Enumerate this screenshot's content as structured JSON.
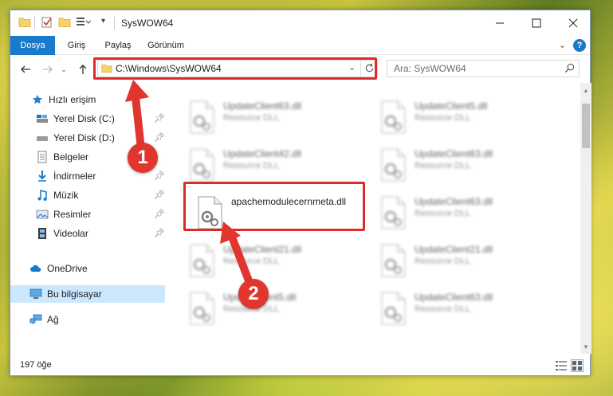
{
  "window": {
    "title": "SysWOW64"
  },
  "ribbon": {
    "tabs": [
      "Dosya",
      "Giriş",
      "Paylaş",
      "Görünüm"
    ]
  },
  "address": {
    "path": "C:\\Windows\\SysWOW64"
  },
  "search": {
    "placeholder": "Ara: SysWOW64"
  },
  "sidebar": {
    "items": [
      {
        "label": "Hızlı erişim",
        "icon": "star-icon"
      },
      {
        "label": "Yerel Disk (C:)",
        "icon": "drive-icon"
      },
      {
        "label": "Yerel Disk (D:)",
        "icon": "drive-icon"
      },
      {
        "label": "Belgeler",
        "icon": "documents-icon"
      },
      {
        "label": "İndirmeler",
        "icon": "download-icon"
      },
      {
        "label": "Müzik",
        "icon": "music-icon"
      },
      {
        "label": "Resimler",
        "icon": "pictures-icon"
      },
      {
        "label": "Videolar",
        "icon": "videos-icon"
      },
      {
        "label": "OneDrive",
        "icon": "cloud-icon"
      },
      {
        "label": "Bu bilgisayar",
        "icon": "computer-icon"
      },
      {
        "label": "Ağ",
        "icon": "network-icon"
      }
    ]
  },
  "files": {
    "left": [
      {
        "name": "UpdateClient63.dll",
        "type": "Resource DLL"
      },
      {
        "name": "UpdateClient42.dll",
        "type": "Resource DLL"
      },
      {
        "name": "apachemodulecernmeta.dll",
        "type": ""
      },
      {
        "name": "UpdateClient21.dll",
        "type": "Resource DLL"
      },
      {
        "name": "UpdateClient5.dll",
        "type": "Resource DLL"
      }
    ],
    "right": [
      {
        "name": "UpdateClient5.dll",
        "type": "Resource DLL"
      },
      {
        "name": "UpdateClient63.dll",
        "type": "Resource DLL"
      },
      {
        "name": "UpdateClient63.dll",
        "type": "Resource DLL"
      },
      {
        "name": "UpdateClient21.dll",
        "type": "Resource DLL"
      },
      {
        "name": "UpdateClient63.dll",
        "type": "Resource DLL"
      }
    ]
  },
  "status": {
    "count": "197 öğe"
  },
  "markers": [
    "1",
    "2"
  ],
  "colors": {
    "accent": "#1979ca",
    "highlight": "#e02a2a",
    "selected": "#cce8ff"
  }
}
